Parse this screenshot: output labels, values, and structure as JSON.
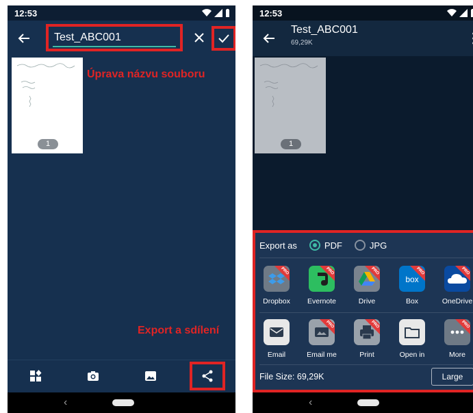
{
  "left": {
    "status": {
      "time": "12:53"
    },
    "title_value": "Test_ABC001",
    "thumbnail": {
      "page_number": "1",
      "scribble_top": "Úprava - Ukázka - výstup"
    },
    "annotations": {
      "rename": "Úprava názvu souboru",
      "export": "Export a sdílení"
    }
  },
  "right": {
    "status": {
      "time": "12:53"
    },
    "title": "Test_ABC001",
    "file_size": "69,29K",
    "thumbnail": {
      "page_number": "1"
    },
    "export": {
      "label": "Export as",
      "options": [
        {
          "label": "PDF",
          "selected": true
        },
        {
          "label": "JPG",
          "selected": false
        }
      ]
    },
    "pro_badge": "PRO",
    "row1": [
      {
        "label": "Dropbox",
        "icon": "dropbox-icon",
        "color": "#6f7a86",
        "pro": true
      },
      {
        "label": "Evernote",
        "icon": "evernote-icon",
        "color": "#2dbe60",
        "pro": true
      },
      {
        "label": "Drive",
        "icon": "drive-icon",
        "color": "#e8e8e8",
        "pro": true
      },
      {
        "label": "Box",
        "icon": "box-icon",
        "color": "#0075c9",
        "pro": true
      },
      {
        "label": "OneDrive",
        "icon": "onedrive-icon",
        "color": "#0a4aa0",
        "pro": true
      }
    ],
    "row2": [
      {
        "label": "Email",
        "icon": "email-icon",
        "color": "#e8e8e8",
        "pro": false
      },
      {
        "label": "Email me",
        "icon": "email-me-icon",
        "color": "#e8e8e8",
        "pro": true
      },
      {
        "label": "Print",
        "icon": "print-icon",
        "color": "#e8e8e8",
        "pro": true
      },
      {
        "label": "Open in",
        "icon": "folder-icon",
        "color": "#e8e8e8",
        "pro": false
      },
      {
        "label": "More",
        "icon": "more-icon",
        "color": "#6f7a86",
        "pro": true
      }
    ],
    "file_size_label": "File Size: 69,29K",
    "size_button": "Large"
  },
  "colors": {
    "accent": "#3fbba6",
    "annotation": "#e02424",
    "app_bg": "#16304f"
  }
}
